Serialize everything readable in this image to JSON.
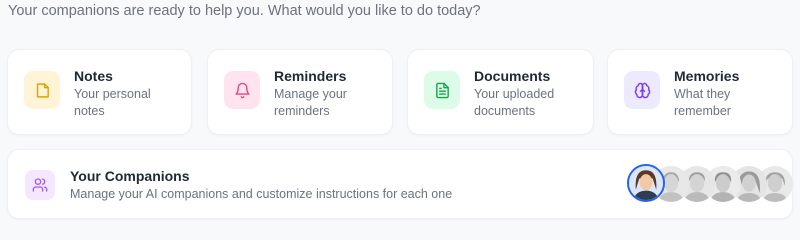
{
  "header": {
    "intro_text": "Your companions are ready to help you. What would you like to do today?"
  },
  "cards": [
    {
      "key": "notes",
      "title": "Notes",
      "description": "Your personal notes",
      "icon": "note-icon",
      "tile_bg": "#fff4d6",
      "icon_color": "#e0a100"
    },
    {
      "key": "reminders",
      "title": "Reminders",
      "description": "Manage your reminders",
      "icon": "bell-icon",
      "tile_bg": "#ffe4ef",
      "icon_color": "#e2487a"
    },
    {
      "key": "documents",
      "title": "Documents",
      "description": "Your uploaded documents",
      "icon": "document-icon",
      "tile_bg": "#dcfce9",
      "icon_color": "#16a34a"
    },
    {
      "key": "memories",
      "title": "Memories",
      "description": "What they remember",
      "icon": "brain-icon",
      "tile_bg": "#ede9fe",
      "icon_color": "#7c3aed"
    }
  ],
  "companions": {
    "title": "Your Companions",
    "description": "Manage your AI companions and customize instructions for each one",
    "icon": "users-icon",
    "tile_bg": "#f3e8ff",
    "icon_color": "#a855f7",
    "accent_color": "#2563eb",
    "avatars": [
      {
        "key": "companion-1",
        "state": "active",
        "color": "color"
      },
      {
        "key": "companion-2",
        "state": "inactive",
        "color": "grayscale"
      },
      {
        "key": "companion-3",
        "state": "inactive",
        "color": "grayscale"
      },
      {
        "key": "companion-4",
        "state": "inactive",
        "color": "grayscale"
      },
      {
        "key": "companion-5",
        "state": "inactive",
        "color": "grayscale"
      },
      {
        "key": "companion-6",
        "state": "inactive",
        "color": "grayscale"
      }
    ]
  }
}
